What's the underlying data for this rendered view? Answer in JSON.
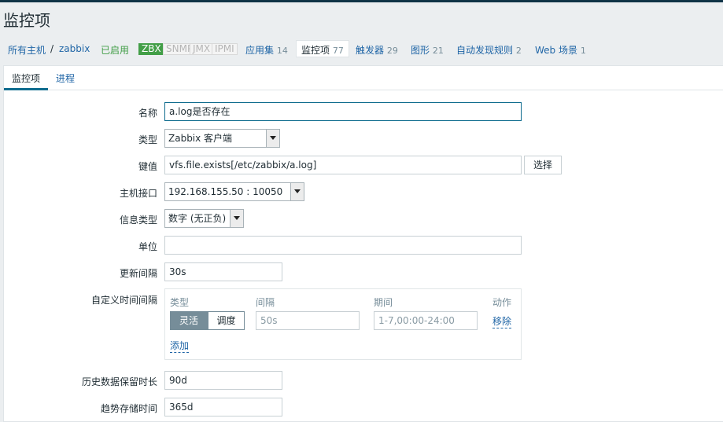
{
  "page": {
    "title": "监控项"
  },
  "breadcrumb": {
    "all_hosts": "所有主机",
    "separator": "/",
    "host": "zabbix",
    "status": "已启用",
    "badges": [
      "ZBX",
      "SNMP",
      "JMX",
      "IPMI"
    ]
  },
  "tabs": [
    {
      "label": "应用集",
      "count": "14"
    },
    {
      "label": "监控项",
      "count": "77"
    },
    {
      "label": "触发器",
      "count": "29"
    },
    {
      "label": "图形",
      "count": "21"
    },
    {
      "label": "自动发现规则",
      "count": "2"
    },
    {
      "label": "Web 场景",
      "count": "1"
    }
  ],
  "subtabs": {
    "items": "监控项",
    "process": "进程"
  },
  "form": {
    "name_label": "名称",
    "name_value": "a.log是否存在",
    "type_label": "类型",
    "type_value": "Zabbix 客户端",
    "key_label": "键值",
    "key_value": "vfs.file.exists[/etc/zabbix/a.log]",
    "select_button": "选择",
    "interface_label": "主机接口",
    "interface_value": "192.168.155.50 : 10050",
    "info_type_label": "信息类型",
    "info_type_value": "数字 (无正负)",
    "units_label": "单位",
    "units_value": "",
    "update_label": "更新间隔",
    "update_value": "30s",
    "custom_label": "自定义时间间隔",
    "custom": {
      "col_type": "类型",
      "col_interval": "间隔",
      "col_period": "期间",
      "col_action": "动作",
      "flexible": "灵活",
      "scheduling": "调度",
      "interval_placeholder": "50s",
      "period_placeholder": "1-7,00:00-24:00",
      "remove": "移除",
      "add": "添加"
    },
    "history_label": "历史数据保留时长",
    "history_value": "90d",
    "trends_label": "趋势存储时间",
    "trends_value": "365d"
  }
}
